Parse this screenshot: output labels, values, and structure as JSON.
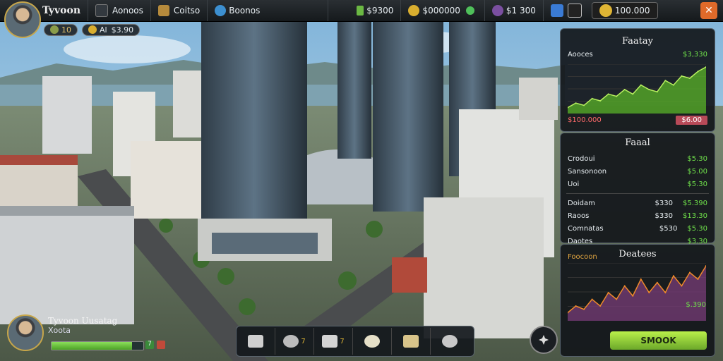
{
  "topbar": {
    "title": "Tyvoon",
    "menu_1": "Aonoos",
    "menu_2": "Coitso",
    "menu_3": "Boonos",
    "money_a": "$9300",
    "money_b": "$000000",
    "money_c": "$1 300",
    "gold": "100.000",
    "close_symbol": "✕"
  },
  "subbar": {
    "level": "10",
    "cash_label": "Al",
    "cash": "$3.90"
  },
  "market_panel": {
    "title": "Faatay",
    "series_label": "Aooces",
    "value": "$3,330",
    "bottom_value": "$100.000",
    "button": "$6.00"
  },
  "finance_panel": {
    "title": "Faaal",
    "rows": [
      {
        "label": "Crodoui",
        "v1": "",
        "v2": "$5.30"
      },
      {
        "label": "Sansonoon",
        "v1": "",
        "v2": "$5.00"
      },
      {
        "label": "Uoi",
        "v1": "",
        "v2": "$5.30"
      }
    ],
    "rows2": [
      {
        "label": "Doidam",
        "v1": "$330",
        "v2": "$5.390"
      },
      {
        "label": "Raoos",
        "v1": "$330",
        "v2": "$13.30"
      },
      {
        "label": "Comnatas",
        "v1": "$530",
        "v2": "$5.30"
      },
      {
        "label": "Daotes",
        "v1": "",
        "v2": "$3.30"
      }
    ]
  },
  "deals_panel": {
    "title": "Deatees",
    "label": "Foocoon",
    "value": "$.390"
  },
  "action_button": "SMOOK",
  "player": {
    "name": "Tyvoon Uusatag",
    "sub": "Xoota",
    "progress": 0.88,
    "bonus": "7"
  },
  "tools": [
    {
      "icon": "wrench-icon",
      "label": ""
    },
    {
      "icon": "helicopter-icon",
      "label": "7"
    },
    {
      "icon": "plane-icon",
      "label": "7"
    },
    {
      "icon": "ring-icon",
      "label": ""
    },
    {
      "icon": "bread-icon",
      "label": ""
    },
    {
      "icon": "medal-icon",
      "label": ""
    }
  ],
  "chart_data": [
    {
      "type": "area",
      "series": [
        {
          "values": [
            1,
            2,
            1.5,
            3,
            2.5,
            4,
            3.5,
            5,
            4,
            6,
            5,
            4.5,
            7,
            6,
            8,
            7.5,
            9,
            10
          ]
        }
      ]
    },
    {
      "type": "area",
      "series": [
        {
          "values": [
            1,
            2,
            1.5,
            3,
            2,
            4,
            3,
            5,
            3.5,
            6,
            4,
            5.5,
            4,
            6.5,
            5,
            7,
            6,
            8
          ]
        }
      ]
    }
  ]
}
